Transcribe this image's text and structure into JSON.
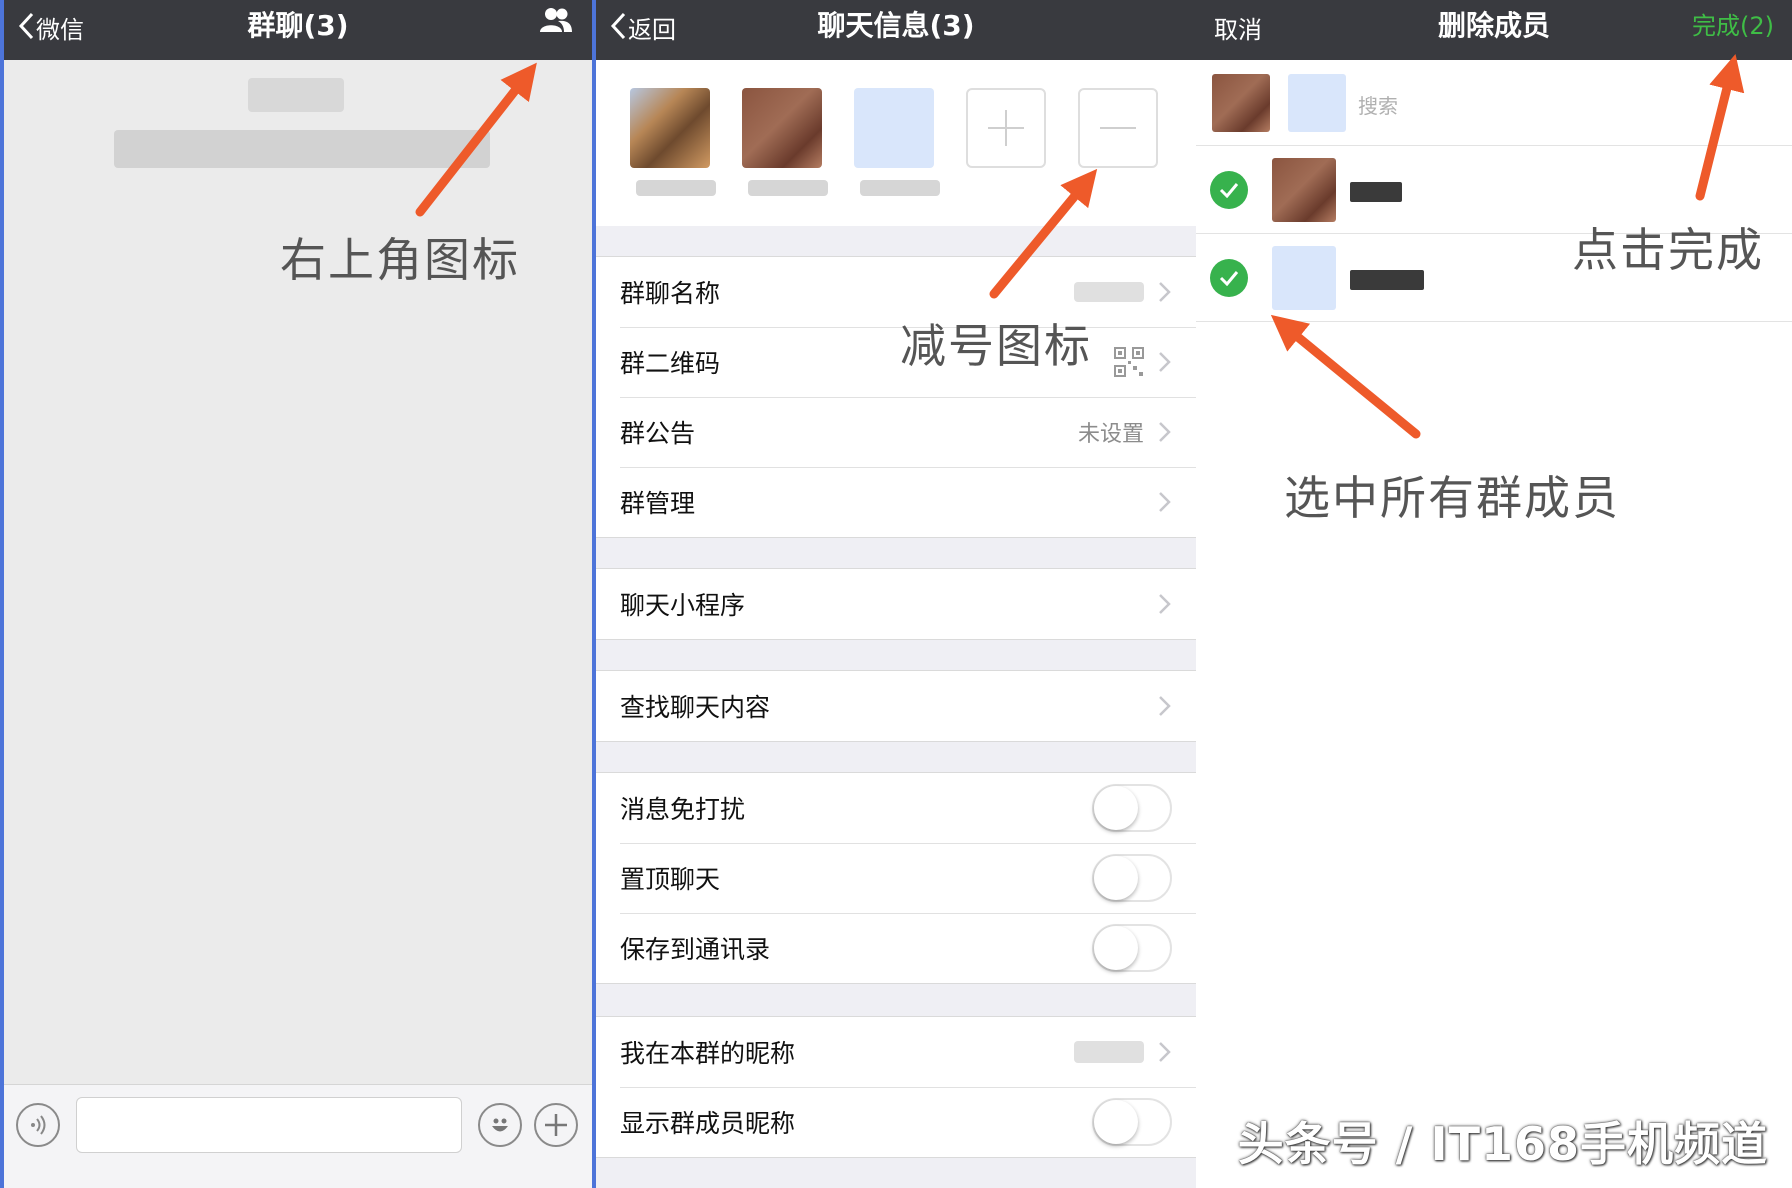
{
  "panel1": {
    "back_label": "微信",
    "title": "群聊(3)",
    "annotation": "右上角图标"
  },
  "panel2": {
    "back_label": "返回",
    "title": "聊天信息(3)",
    "annotation": "减号图标",
    "group1": [
      {
        "label": "群聊名称",
        "value": ""
      },
      {
        "label": "群二维码",
        "value": ""
      },
      {
        "label": "群公告",
        "value": "未设置"
      },
      {
        "label": "群管理",
        "value": ""
      }
    ],
    "group2": [
      {
        "label": "聊天小程序"
      }
    ],
    "group3": [
      {
        "label": "查找聊天内容"
      }
    ],
    "group4": [
      {
        "label": "消息免打扰",
        "on": false
      },
      {
        "label": "置顶聊天",
        "on": false
      },
      {
        "label": "保存到通讯录",
        "on": false
      }
    ],
    "group5": [
      {
        "label": "我在本群的昵称"
      },
      {
        "label": "显示群成员昵称",
        "on": false
      }
    ]
  },
  "panel3": {
    "cancel_label": "取消",
    "title": "删除成员",
    "done_label": "完成(2)",
    "search_placeholder": "搜索",
    "annotation_done": "点击完成",
    "annotation_select": "选中所有群成员"
  },
  "watermark": "头条号 / IT168手机频道",
  "colors": {
    "navbar": "#393a3f",
    "done_green": "#3fbd46",
    "check_green": "#37b24d",
    "arrow": "#ee5a2a"
  }
}
